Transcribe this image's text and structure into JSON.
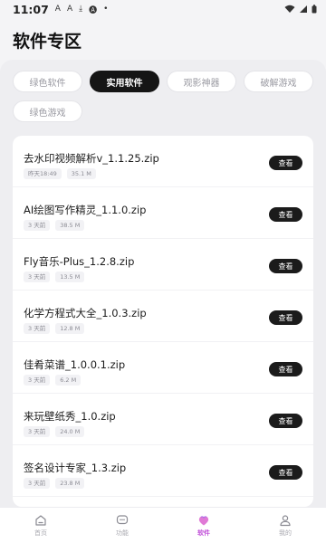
{
  "status": {
    "time": "11:07",
    "icons": [
      "font-a-icon",
      "font-a-icon",
      "download-icon",
      "font-a-box-icon",
      "dot-icon"
    ],
    "right_icons": [
      "wifi-icon",
      "signal-icon",
      "battery-icon"
    ]
  },
  "header": {
    "title": "软件专区"
  },
  "tabs": [
    {
      "label": "绿色软件",
      "active": false
    },
    {
      "label": "实用软件",
      "active": true
    },
    {
      "label": "观影神器",
      "active": false
    },
    {
      "label": "破解游戏",
      "active": false
    },
    {
      "label": "绿色游戏",
      "active": false
    }
  ],
  "items": [
    {
      "name": "去水印视频解析v_1.1.25.zip",
      "time": "昨天18:49",
      "size": "35.1 M",
      "action": "查看"
    },
    {
      "name": "AI绘图写作精灵_1.1.0.zip",
      "time": "3 天前",
      "size": "38.5 M",
      "action": "查看"
    },
    {
      "name": "Fly音乐-Plus_1.2.8.zip",
      "time": "3 天前",
      "size": "13.5 M",
      "action": "查看"
    },
    {
      "name": "化学方程式大全_1.0.3.zip",
      "time": "3 天前",
      "size": "12.8 M",
      "action": "查看"
    },
    {
      "name": "佳肴菜谱_1.0.0.1.zip",
      "time": "3 天前",
      "size": "6.2 M",
      "action": "查看"
    },
    {
      "name": "来玩壁纸秀_1.0.zip",
      "time": "3 天前",
      "size": "24.0 M",
      "action": "查看"
    },
    {
      "name": "签名设计专家_1.3.zip",
      "time": "3 天前",
      "size": "23.8 M",
      "action": "查看"
    }
  ],
  "nav": [
    {
      "label": "首页",
      "icon": "home-icon",
      "active": false
    },
    {
      "label": "功能",
      "icon": "chat-icon",
      "active": false
    },
    {
      "label": "软件",
      "icon": "software-icon",
      "active": true
    },
    {
      "label": "我的",
      "icon": "user-icon",
      "active": false
    }
  ],
  "colors": {
    "accent": "#c04fd8",
    "button": "#1b1b1b",
    "background": "#f4f4f6"
  }
}
